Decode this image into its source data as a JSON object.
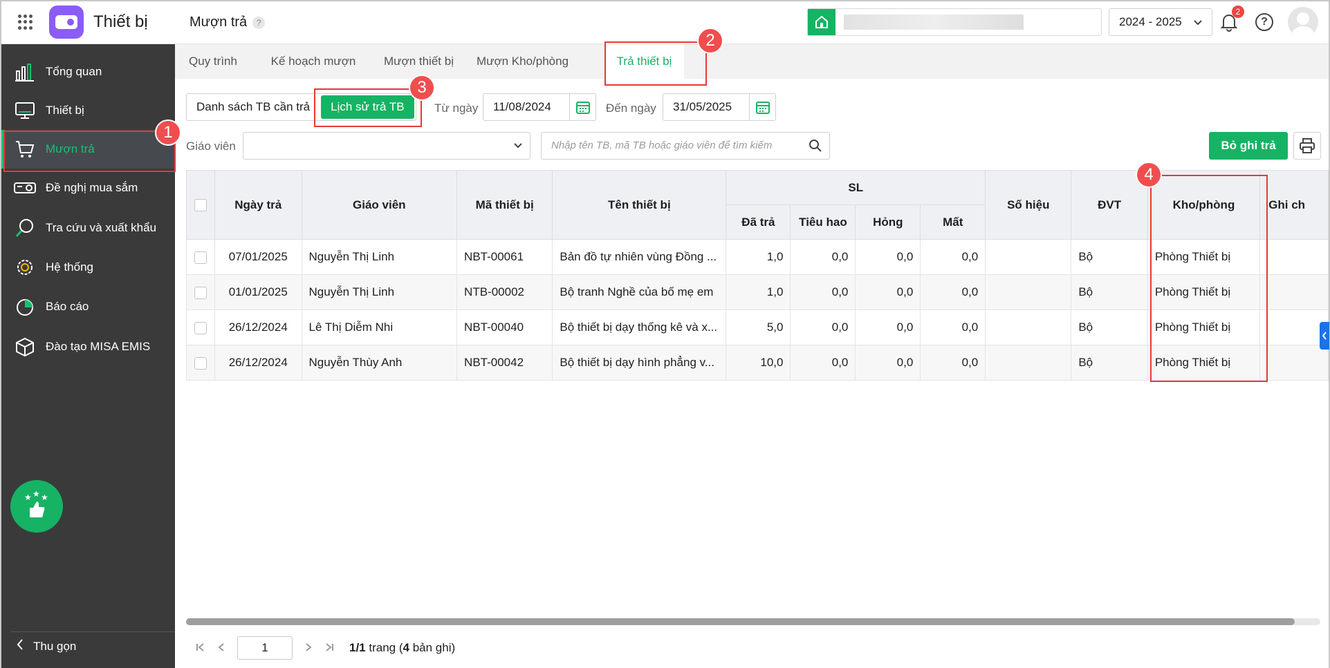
{
  "header": {
    "app_title": "Thiết bị",
    "page_title": "Mượn trả",
    "help_mark": "?",
    "year": "2024 - 2025",
    "notification_count": "2",
    "help_icon_text": "?"
  },
  "sidebar": {
    "items": [
      {
        "label": "Tổng quan",
        "icon": "chart-icon"
      },
      {
        "label": "Thiết bị",
        "icon": "monitor-icon"
      },
      {
        "label": "Mượn trả",
        "icon": "cart-icon"
      },
      {
        "label": "Đề nghị mua sắm",
        "icon": "projector-icon"
      },
      {
        "label": "Tra cứu và xuất khẩu",
        "icon": "search-icon"
      },
      {
        "label": "Hệ thống",
        "icon": "gear-icon"
      },
      {
        "label": "Báo cáo",
        "icon": "pie-icon"
      },
      {
        "label": "Đào tạo MISA EMIS",
        "icon": "cube-icon"
      }
    ],
    "active_index": 2,
    "collapse_label": "Thu gọn"
  },
  "tabs": [
    "Quy trình",
    "Kế hoạch mượn",
    "Mượn thiết bị",
    "Mượn Kho/phòng",
    "Trả thiết bị"
  ],
  "active_tab": 4,
  "filters": {
    "seg_list": "Danh sách TB cần trả",
    "seg_history": "Lịch sử trả TB",
    "from_label": "Từ ngày",
    "from_date": "11/08/2024",
    "to_label": "Đến ngày",
    "to_date": "31/05/2025",
    "teacher_label": "Giáo viên",
    "teacher_value": "",
    "search_placeholder": "Nhập tên TB, mã TB hoặc giáo viên để tìm kiếm",
    "unreturn_button": "Bỏ ghi trả"
  },
  "table": {
    "headers": {
      "date": "Ngày trả",
      "teacher": "Giáo viên",
      "code": "Mã thiết bị",
      "name": "Tên thiết bị",
      "sl": "SL",
      "returned": "Đã trả",
      "consumed": "Tiêu hao",
      "broken": "Hỏng",
      "lost": "Mất",
      "serial": "Số hiệu",
      "unit": "ĐVT",
      "room": "Kho/phòng",
      "note": "Ghi ch"
    },
    "rows": [
      {
        "date": "07/01/2025",
        "teacher": "Nguyễn Thị Linh",
        "code": "NBT-00061",
        "name": "Bản đồ tự nhiên vùng Đồng ...",
        "returned": "1,0",
        "consumed": "0,0",
        "broken": "0,0",
        "lost": "0,0",
        "serial": "",
        "unit": "Bộ",
        "room": "Phòng Thiết bị",
        "note": ""
      },
      {
        "date": "01/01/2025",
        "teacher": "Nguyễn Thị Linh",
        "code": "NTB-00002",
        "name": "Bộ tranh Nghề của bố mẹ em",
        "returned": "1,0",
        "consumed": "0,0",
        "broken": "0,0",
        "lost": "0,0",
        "serial": "",
        "unit": "Bộ",
        "room": "Phòng Thiết bị",
        "note": ""
      },
      {
        "date": "26/12/2024",
        "teacher": "Lê Thị Diễm Nhi",
        "code": "NBT-00040",
        "name": "Bộ thiết bị dạy thống kê và x...",
        "returned": "5,0",
        "consumed": "0,0",
        "broken": "0,0",
        "lost": "0,0",
        "serial": "",
        "unit": "Bộ",
        "room": "Phòng Thiết bị",
        "note": ""
      },
      {
        "date": "26/12/2024",
        "teacher": "Nguyễn Thùy Anh",
        "code": "NBT-00042",
        "name": "Bộ thiết bị dạy hình phẳng v...",
        "returned": "10,0",
        "consumed": "0,0",
        "broken": "0,0",
        "lost": "0,0",
        "serial": "",
        "unit": "Bộ",
        "room": "Phòng Thiết bị",
        "note": ""
      }
    ]
  },
  "pagination": {
    "current_page": "1",
    "page_fraction": "1/1",
    "page_word": "trang",
    "record_count": "4",
    "record_word": "bản ghi"
  },
  "annotations": [
    "1",
    "2",
    "3",
    "4"
  ],
  "colors": {
    "accent": "#16b364",
    "sidebar": "#3a3a3a",
    "annotation": "#e53935"
  }
}
